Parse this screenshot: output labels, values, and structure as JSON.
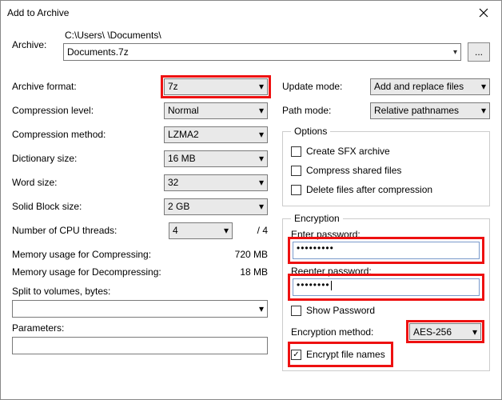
{
  "window": {
    "title": "Add to Archive"
  },
  "archive": {
    "label": "Archive:",
    "path": "C:\\Users\\        \\Documents\\",
    "filename": "Documents.7z",
    "browse": "..."
  },
  "left": {
    "format": {
      "label": "Archive format:",
      "value": "7z"
    },
    "level": {
      "label": "Compression level:",
      "value": "Normal"
    },
    "method": {
      "label": "Compression method:",
      "value": "LZMA2"
    },
    "dict": {
      "label": "Dictionary size:",
      "value": "16 MB"
    },
    "word": {
      "label": "Word size:",
      "value": "32"
    },
    "block": {
      "label": "Solid Block size:",
      "value": "2 GB"
    },
    "cpu": {
      "label": "Number of CPU threads:",
      "value": "4",
      "total": "/ 4"
    },
    "memC": {
      "label": "Memory usage for Compressing:",
      "value": "720 MB"
    },
    "memD": {
      "label": "Memory usage for Decompressing:",
      "value": "18 MB"
    },
    "split": {
      "label": "Split to volumes, bytes:",
      "value": ""
    },
    "params": {
      "label": "Parameters:",
      "value": ""
    }
  },
  "right": {
    "update": {
      "label": "Update mode:",
      "value": "Add and replace files"
    },
    "pathmode": {
      "label": "Path mode:",
      "value": "Relative pathnames"
    },
    "options": {
      "legend": "Options",
      "sfx": "Create SFX archive",
      "shared": "Compress shared files",
      "delete": "Delete files after compression"
    },
    "encryption": {
      "legend": "Encryption",
      "enter": "Enter password:",
      "reenter": "Reenter password:",
      "pwd1": "•••••••••",
      "pwd2": "••••••••",
      "show": "Show Password",
      "method_label": "Encryption method:",
      "method_value": "AES-256",
      "names": "Encrypt file names"
    }
  }
}
